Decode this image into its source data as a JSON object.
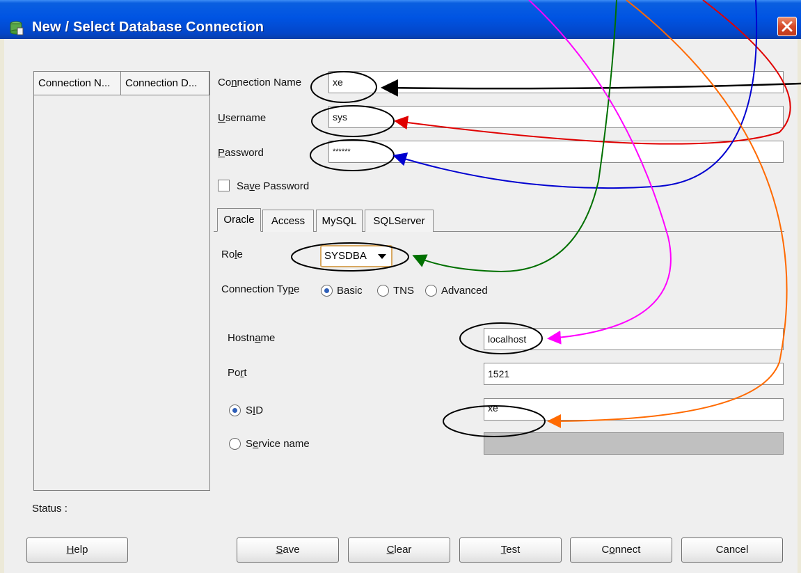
{
  "window": {
    "title": "New / Select Database Connection",
    "close_label": "X"
  },
  "list": {
    "columns": [
      "Connection N...",
      "Connection D..."
    ]
  },
  "form": {
    "connection_name": {
      "pre": "Co",
      "ul": "n",
      "post": "nection Name",
      "value": "xe"
    },
    "username": {
      "pre": "",
      "ul": "U",
      "post": "sername",
      "value": "sys"
    },
    "password": {
      "pre": "",
      "ul": "P",
      "post": "assword",
      "value": "******"
    },
    "save_password": {
      "pre": "Sa",
      "ul": "v",
      "post": "e Password",
      "checked": false
    }
  },
  "tabs": [
    "Oracle",
    "Access",
    "MySQL",
    "SQLServer"
  ],
  "oracle": {
    "role": {
      "pre": "Ro",
      "ul": "l",
      "post": "e",
      "value": "SYSDBA"
    },
    "connection_type": {
      "pre": "Connection Ty",
      "ul": "p",
      "post": "e",
      "options": [
        "Basic",
        "TNS",
        "Advanced"
      ],
      "selected": "Basic"
    },
    "hostname": {
      "pre": "Hostn",
      "ul": "a",
      "post": "me",
      "value": "localhost"
    },
    "port": {
      "pre": "Po",
      "ul": "r",
      "post": "t",
      "value": "1521"
    },
    "sid": {
      "pre": "S",
      "ul": "I",
      "post": "D",
      "value": "xe",
      "selected": true
    },
    "service_name": {
      "pre": "S",
      "ul": "e",
      "post": "rvice name",
      "value": ""
    }
  },
  "status": {
    "label": "Status :"
  },
  "buttons": {
    "help": {
      "pre": "",
      "ul": "H",
      "post": "elp"
    },
    "save": {
      "pre": "",
      "ul": "S",
      "post": "ave"
    },
    "clear": {
      "pre": "",
      "ul": "C",
      "post": "lear"
    },
    "test": {
      "pre": "",
      "ul": "T",
      "post": "est"
    },
    "connect": {
      "pre": "C",
      "ul": "o",
      "post": "nnect"
    },
    "cancel": {
      "pre": "",
      "ul": "",
      "post": "Cancel"
    }
  },
  "colors": {
    "titlebar": "#0054e3",
    "close": "#d64a2a",
    "window_bg": "#efefef"
  }
}
